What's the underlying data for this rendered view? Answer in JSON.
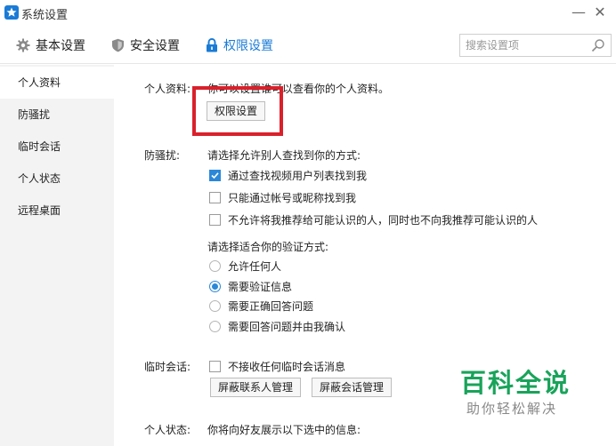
{
  "window": {
    "title": "系统设置",
    "minimize_glyph": "—",
    "close_glyph": "✕"
  },
  "tabs": [
    {
      "label": "基本设置",
      "icon": "gear-icon"
    },
    {
      "label": "安全设置",
      "icon": "shield-icon"
    },
    {
      "label": "权限设置",
      "icon": "lock-icon",
      "active": true
    }
  ],
  "search": {
    "placeholder": "搜索设置项",
    "value": ""
  },
  "sidebar": {
    "items": [
      {
        "label": "个人资料",
        "active": true
      },
      {
        "label": "防骚扰"
      },
      {
        "label": "临时会话"
      },
      {
        "label": "个人状态"
      },
      {
        "label": "远程桌面"
      }
    ]
  },
  "profile": {
    "label": "个人资料:",
    "desc": "你可以设置谁可以查看你的个人资料。",
    "button": "权限设置"
  },
  "harass": {
    "label": "防骚扰:",
    "find_prompt": "请选择允许别人查找到你的方式:",
    "find_options": [
      {
        "label": "通过查找视频用户列表找到我",
        "checked": true
      },
      {
        "label": "只能通过帐号或昵称找到我",
        "checked": false
      },
      {
        "label": "不允许将我推荐给可能认识的人，同时也不向我推荐可能认识的人",
        "checked": false
      }
    ],
    "verify_prompt": "请选择适合你的验证方式:",
    "verify_options": [
      {
        "label": "允许任何人",
        "checked": false
      },
      {
        "label": "需要验证信息",
        "checked": true
      },
      {
        "label": "需要正确回答问题",
        "checked": false
      },
      {
        "label": "需要回答问题并由我确认",
        "checked": false
      }
    ]
  },
  "temp_chat": {
    "label": "临时会话:",
    "option": {
      "label": "不接收任何临时会话消息",
      "checked": false
    },
    "buttons": [
      "屏蔽联系人管理",
      "屏蔽会话管理"
    ]
  },
  "status": {
    "label": "个人状态:",
    "desc": "你将向好友展示以下选中的信息:"
  },
  "watermark": {
    "title": "百科全说",
    "subtitle": "助你轻松解决"
  },
  "colors": {
    "accent": "#1a7bd6",
    "checkbox": "#2b88d8",
    "highlight": "#d9212c",
    "watermark": "#19a35a"
  }
}
